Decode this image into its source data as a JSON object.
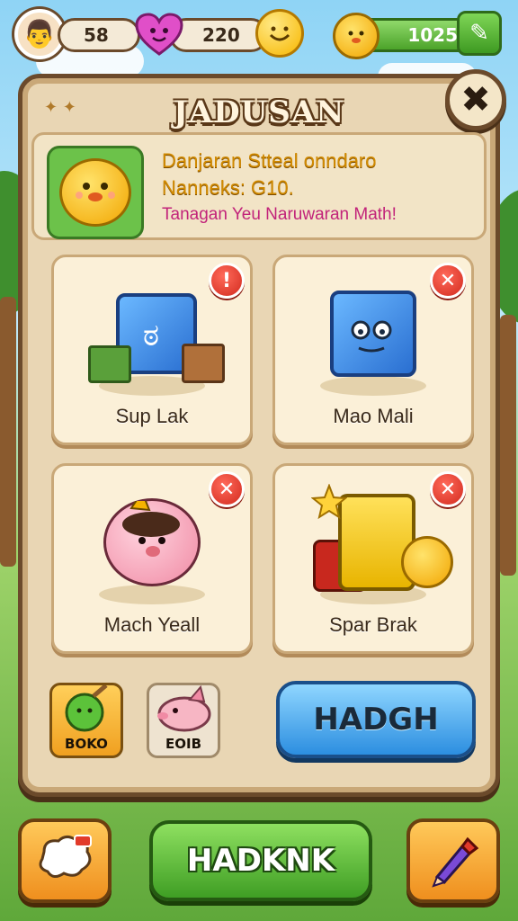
{
  "hud": {
    "lives": "58",
    "hearts": "220",
    "gems": "1025"
  },
  "panel": {
    "title": "JADUSAN",
    "close_glyph": "✖",
    "info": {
      "line1": "Danjaran Stteal onndaro",
      "line2": "Nanneks: G10.",
      "line3": "Tanagan Yeu Naruwaran Math!"
    },
    "cards": [
      {
        "label": "Sup Lak",
        "badge": "!"
      },
      {
        "label": "Mao Mali",
        "badge": "✕"
      },
      {
        "label": "Mach Yeall",
        "badge": "✕"
      },
      {
        "label": "Spar Brak",
        "badge": "✕"
      }
    ],
    "slots": [
      {
        "label": "BOKO"
      },
      {
        "label": "EOIB"
      }
    ],
    "action_button": "HADGH"
  },
  "bottom": {
    "main_button": "HADKNK"
  },
  "colors": {
    "panel_bg": "#e9d6b4",
    "panel_border": "#6b4a2b",
    "badge_red": "#d22a1e",
    "blue_button": "#2c8ee0",
    "green_button": "#3f9e24",
    "orange_button": "#ef8f1e"
  }
}
